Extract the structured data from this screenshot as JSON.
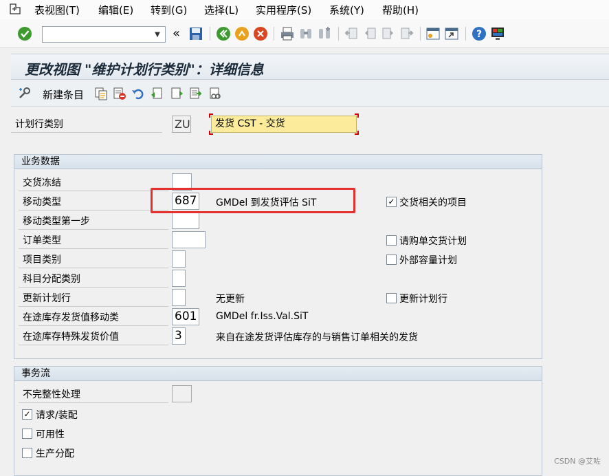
{
  "menubar": {
    "items": [
      "表视图(T)",
      "编辑(E)",
      "转到(G)",
      "选择(L)",
      "实用程序(S)",
      "系统(Y)",
      "帮助(H)"
    ]
  },
  "toolbar": {
    "command_field_value": "",
    "icons": [
      "enter-icon",
      "save-icon",
      "back-icon",
      "exit-icon",
      "cancel-icon",
      "print-icon",
      "find-icon",
      "find-next-icon",
      "first-page-icon",
      "prev-page-icon",
      "next-page-icon",
      "last-page-icon",
      "create-session-icon",
      "shortcut-icon",
      "help-icon",
      "layout-icon"
    ]
  },
  "title": "更改视图 \"维护计划行类别\"：详细信息",
  "app_toolbar": {
    "new_entries_label": "新建条目"
  },
  "header": {
    "label": "计划行类别",
    "code": "ZU",
    "description": "发货 CST - 交货"
  },
  "business_data": {
    "title": "业务数据",
    "rows": [
      {
        "label": "交货冻结",
        "value": "",
        "text": ""
      },
      {
        "label": "移动类型",
        "value": "687",
        "text": "GMDel 到发货评估 SiT"
      },
      {
        "label": "移动类型第一步",
        "value": "",
        "text": ""
      },
      {
        "label": "订单类型",
        "value": "",
        "text": ""
      },
      {
        "label": "项目类别",
        "value": "",
        "text": ""
      },
      {
        "label": "科目分配类别",
        "value": "",
        "text": ""
      },
      {
        "label": "更新计划行",
        "value": "",
        "text": "无更新"
      },
      {
        "label": "在途库存发货值移动类",
        "value": "601",
        "text": "GMDel fr.Iss.Val.SiT"
      },
      {
        "label": "在途库存特殊发货价值",
        "value": "3",
        "text": "来自在途发货评估库存的与销售订单相关的发货"
      }
    ],
    "checkboxes": [
      {
        "label": "交货相关的项目",
        "checked": true
      },
      {
        "label": "请购单交货计划",
        "checked": false
      },
      {
        "label": "外部容量计划",
        "checked": false
      },
      {
        "label": "更新计划行",
        "checked": false
      }
    ]
  },
  "transaction_flow": {
    "title": "事务流",
    "incompletion_label": "不完整性处理",
    "incompletion_value": "",
    "checkboxes": [
      {
        "label": "请求/装配",
        "checked": true
      },
      {
        "label": "可用性",
        "checked": false
      },
      {
        "label": "生产分配",
        "checked": false
      }
    ]
  },
  "watermark": "CSDN @艾咗",
  "colors": {
    "accent_red": "#e53030",
    "title_bg": "#e4eaf0",
    "field_yellow": "#fbeb9a"
  }
}
